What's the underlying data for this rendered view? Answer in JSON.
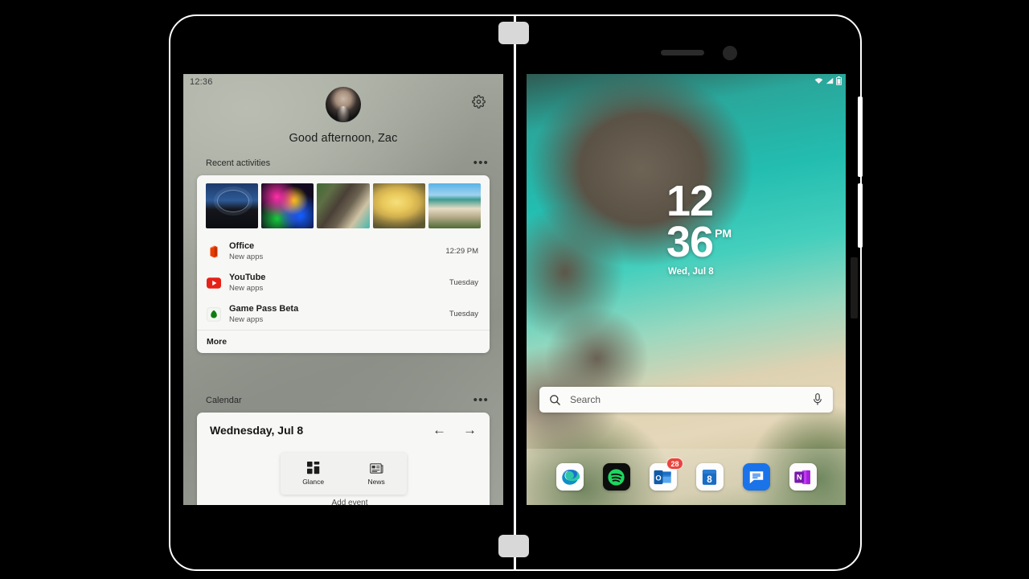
{
  "device": {
    "hinge_tab_top": "hinge-tab",
    "hinge_tab_bottom": "hinge-tab",
    "speaker": "speaker-grille",
    "camera": "front-camera"
  },
  "left_screen": {
    "status_time": "12:36",
    "greeting": "Good afternoon, Zac",
    "settings_icon": "gear-icon",
    "avatar": "user-avatar",
    "recent": {
      "title": "Recent activities",
      "overflow": "•••",
      "thumbnails": [
        {
          "name": "star-trails-thumbnail"
        },
        {
          "name": "colorful-smoke-thumbnail"
        },
        {
          "name": "rocky-coastline-thumbnail"
        },
        {
          "name": "mushroom-thumbnail"
        },
        {
          "name": "beach-cove-thumbnail"
        }
      ],
      "items": [
        {
          "icon": "office-icon",
          "name": "Office",
          "sub": "New apps",
          "time": "12:29 PM"
        },
        {
          "icon": "youtube-icon",
          "name": "YouTube",
          "sub": "New apps",
          "time": "Tuesday"
        },
        {
          "icon": "game-pass-icon",
          "name": "Game Pass Beta",
          "sub": "New apps",
          "time": "Tuesday"
        }
      ],
      "more_label": "More"
    },
    "calendar": {
      "title": "Calendar",
      "overflow": "•••",
      "date": "Wednesday, Jul 8",
      "prev_arrow": "←",
      "next_arrow": "→",
      "add_event_label": "Add event"
    },
    "tabs": [
      {
        "label": "Glance",
        "icon": "grid-icon"
      },
      {
        "label": "News",
        "icon": "newspaper-icon"
      }
    ]
  },
  "right_screen": {
    "status_icons": [
      "wifi-icon",
      "signal-icon",
      "battery-icon"
    ],
    "clock": {
      "hour": "12",
      "minute": "36",
      "ampm": "PM",
      "date": "Wed, Jul 8"
    },
    "search": {
      "placeholder": "Search",
      "search_icon": "search-icon",
      "mic_icon": "microphone-icon"
    },
    "dock": [
      {
        "name": "edge-icon",
        "label": "Edge",
        "badge": null
      },
      {
        "name": "spotify-icon",
        "label": "Spotify",
        "badge": null
      },
      {
        "name": "outlook-icon",
        "label": "Outlook",
        "badge": "28"
      },
      {
        "name": "calendar-icon",
        "label": "Calendar",
        "badge": null,
        "day": "8"
      },
      {
        "name": "messages-icon",
        "label": "Messages",
        "badge": null
      },
      {
        "name": "onenote-icon",
        "label": "OneNote",
        "badge": null
      }
    ]
  },
  "colors": {
    "badge_red": "#e8453c",
    "frame_white": "#ffffff",
    "background_black": "#000000",
    "card_white": "#f7f7f5"
  }
}
